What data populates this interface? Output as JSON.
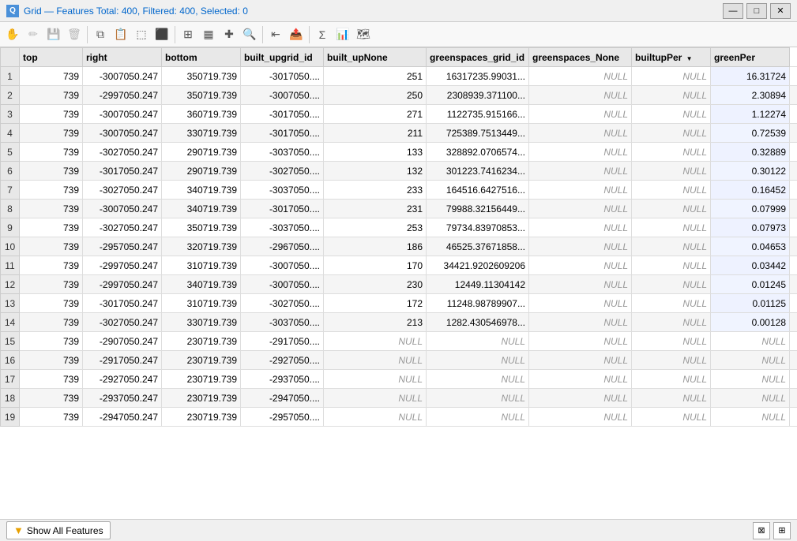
{
  "titleBar": {
    "icon": "Q",
    "title": "Grid — Features Total: 400, Filtered: 400, Selected: 0",
    "titleParts": {
      "prefix": "Grid — ",
      "stats": "Features Total: 400, Filtered: 400, Selected: 0"
    },
    "controls": {
      "minimize": "—",
      "maximize": "□",
      "close": "✕"
    }
  },
  "toolbar": {
    "buttons": [
      {
        "name": "pan-icon",
        "symbol": "✋",
        "tooltip": "Pan",
        "disabled": false
      },
      {
        "name": "edit-icon",
        "symbol": "✏️",
        "tooltip": "Edit",
        "disabled": true
      },
      {
        "name": "save-icon",
        "symbol": "💾",
        "tooltip": "Save",
        "disabled": true
      },
      {
        "name": "delete-icon",
        "symbol": "🗑",
        "tooltip": "Delete",
        "disabled": true
      },
      {
        "name": "separator1",
        "type": "separator"
      },
      {
        "name": "copy-icon",
        "symbol": "⧉",
        "tooltip": "Copy",
        "disabled": false
      },
      {
        "name": "paste-icon",
        "symbol": "📋",
        "tooltip": "Paste",
        "disabled": false
      },
      {
        "name": "zoom-icon",
        "symbol": "🔍",
        "tooltip": "Zoom",
        "disabled": false
      },
      {
        "name": "select-icon",
        "symbol": "⬛",
        "tooltip": "Select",
        "disabled": false
      },
      {
        "name": "separator2",
        "type": "separator"
      },
      {
        "name": "filter-icon",
        "symbol": "⊞",
        "tooltip": "Filter",
        "disabled": false
      },
      {
        "name": "table-icon",
        "symbol": "▦",
        "tooltip": "Table",
        "disabled": false
      },
      {
        "name": "add-col-icon",
        "symbol": "✚",
        "tooltip": "Add Column",
        "disabled": false
      },
      {
        "name": "search-icon",
        "symbol": "🔎",
        "tooltip": "Search",
        "disabled": false
      },
      {
        "name": "separator3",
        "type": "separator"
      },
      {
        "name": "move-top-icon",
        "symbol": "⇤",
        "tooltip": "Move Top",
        "disabled": false
      },
      {
        "name": "export-icon",
        "symbol": "📤",
        "tooltip": "Export",
        "disabled": false
      },
      {
        "name": "separator4",
        "type": "separator"
      },
      {
        "name": "stats-icon",
        "symbol": "Σ",
        "tooltip": "Statistics",
        "disabled": false
      },
      {
        "name": "chart-icon",
        "symbol": "📊",
        "tooltip": "Chart",
        "disabled": false
      },
      {
        "name": "map-icon",
        "symbol": "🗺",
        "tooltip": "Map",
        "disabled": false
      }
    ]
  },
  "columns": [
    {
      "id": "rownum",
      "label": "",
      "width": 24
    },
    {
      "id": "top",
      "label": "top",
      "width": 80
    },
    {
      "id": "right",
      "label": "right",
      "width": 100
    },
    {
      "id": "bottom",
      "label": "bottom",
      "width": 100
    },
    {
      "id": "built_upgrid_id",
      "label": "built_upgrid_id",
      "width": 105
    },
    {
      "id": "built_upNone",
      "label": "built_upNone",
      "width": 130
    },
    {
      "id": "greenspaces_grid_id",
      "label": "greenspaces_grid_id",
      "width": 130
    },
    {
      "id": "greenspaces_None",
      "label": "greenspaces_None",
      "width": 130
    },
    {
      "id": "builtupPer",
      "label": "builtupPer",
      "width": 100,
      "sorted": "desc"
    },
    {
      "id": "greenPer",
      "label": "greenPer",
      "width": 80
    }
  ],
  "rows": [
    {
      "num": 1,
      "top": "739",
      "right": "-3007050.247",
      "bottom": "350719.739",
      "btm2": "-3017050....",
      "built_upgrid_id": "251",
      "built_upNone": "16317235.99031...",
      "greenspaces_grid_id": "NULL",
      "greenspaces_None": "NULL",
      "builtupPer": "16.31724",
      "greenPer": "16.32"
    },
    {
      "num": 2,
      "top": "739",
      "right": "-2997050.247",
      "bottom": "350719.739",
      "btm2": "-3007050....",
      "built_upgrid_id": "250",
      "built_upNone": "2308939.371100...",
      "greenspaces_grid_id": "NULL",
      "greenspaces_None": "NULL",
      "builtupPer": "2.30894",
      "greenPer": "2.31"
    },
    {
      "num": 3,
      "top": "739",
      "right": "-3007050.247",
      "bottom": "360719.739",
      "btm2": "-3017050....",
      "built_upgrid_id": "271",
      "built_upNone": "1122735.915166...",
      "greenspaces_grid_id": "NULL",
      "greenspaces_None": "NULL",
      "builtupPer": "1.12274",
      "greenPer": "1.12"
    },
    {
      "num": 4,
      "top": "739",
      "right": "-3007050.247",
      "bottom": "330719.739",
      "btm2": "-3017050....",
      "built_upgrid_id": "211",
      "built_upNone": "725389.7513449...",
      "greenspaces_grid_id": "NULL",
      "greenspaces_None": "NULL",
      "builtupPer": "0.72539",
      "greenPer": "0.73"
    },
    {
      "num": 5,
      "top": "739",
      "right": "-3027050.247",
      "bottom": "290719.739",
      "btm2": "-3037050....",
      "built_upgrid_id": "133",
      "built_upNone": "328892.0706574...",
      "greenspaces_grid_id": "NULL",
      "greenspaces_None": "NULL",
      "builtupPer": "0.32889",
      "greenPer": "0.33"
    },
    {
      "num": 6,
      "top": "739",
      "right": "-3017050.247",
      "bottom": "290719.739",
      "btm2": "-3027050....",
      "built_upgrid_id": "132",
      "built_upNone": "301223.7416234...",
      "greenspaces_grid_id": "NULL",
      "greenspaces_None": "NULL",
      "builtupPer": "0.30122",
      "greenPer": "0.3"
    },
    {
      "num": 7,
      "top": "739",
      "right": "-3027050.247",
      "bottom": "340719.739",
      "btm2": "-3037050....",
      "built_upgrid_id": "233",
      "built_upNone": "164516.6427516...",
      "greenspaces_grid_id": "NULL",
      "greenspaces_None": "NULL",
      "builtupPer": "0.16452",
      "greenPer": "0.16"
    },
    {
      "num": 8,
      "top": "739",
      "right": "-3007050.247",
      "bottom": "340719.739",
      "btm2": "-3017050....",
      "built_upgrid_id": "231",
      "built_upNone": "79988.32156449...",
      "greenspaces_grid_id": "NULL",
      "greenspaces_None": "NULL",
      "builtupPer": "0.07999",
      "greenPer": "0.08"
    },
    {
      "num": 9,
      "top": "739",
      "right": "-3027050.247",
      "bottom": "350719.739",
      "btm2": "-3037050....",
      "built_upgrid_id": "253",
      "built_upNone": "79734.83970853...",
      "greenspaces_grid_id": "NULL",
      "greenspaces_None": "NULL",
      "builtupPer": "0.07973",
      "greenPer": "0.08"
    },
    {
      "num": 10,
      "top": "739",
      "right": "-2957050.247",
      "bottom": "320719.739",
      "btm2": "-2967050....",
      "built_upgrid_id": "186",
      "built_upNone": "46525.37671858...",
      "greenspaces_grid_id": "NULL",
      "greenspaces_None": "NULL",
      "builtupPer": "0.04653",
      "greenPer": "0.05"
    },
    {
      "num": 11,
      "top": "739",
      "right": "-2997050.247",
      "bottom": "310719.739",
      "btm2": "-3007050....",
      "built_upgrid_id": "170",
      "built_upNone": "34421.9202609206",
      "greenspaces_grid_id": "NULL",
      "greenspaces_None": "NULL",
      "builtupPer": "0.03442",
      "greenPer": "0.03"
    },
    {
      "num": 12,
      "top": "739",
      "right": "-2997050.247",
      "bottom": "340719.739",
      "btm2": "-3007050....",
      "built_upgrid_id": "230",
      "built_upNone": "12449.11304142",
      "greenspaces_grid_id": "NULL",
      "greenspaces_None": "NULL",
      "builtupPer": "0.01245",
      "greenPer": "0.01"
    },
    {
      "num": 13,
      "top": "739",
      "right": "-3017050.247",
      "bottom": "310719.739",
      "btm2": "-3027050....",
      "built_upgrid_id": "172",
      "built_upNone": "11248.98789907...",
      "greenspaces_grid_id": "NULL",
      "greenspaces_None": "NULL",
      "builtupPer": "0.01125",
      "greenPer": "0.01"
    },
    {
      "num": 14,
      "top": "739",
      "right": "-3027050.247",
      "bottom": "330719.739",
      "btm2": "-3037050....",
      "built_upgrid_id": "213",
      "built_upNone": "1282.430546978...",
      "greenspaces_grid_id": "NULL",
      "greenspaces_None": "NULL",
      "builtupPer": "0.00128",
      "greenPer": "0"
    },
    {
      "num": 15,
      "top": "739",
      "right": "-2907050.247",
      "bottom": "230719.739",
      "btm2": "-2917050....",
      "built_upgrid_id": "NULL",
      "built_upNone": "NULL",
      "greenspaces_grid_id": "NULL",
      "greenspaces_None": "NULL",
      "builtupPer": "NULL",
      "greenPer": "NULL"
    },
    {
      "num": 16,
      "top": "739",
      "right": "-2917050.247",
      "bottom": "230719.739",
      "btm2": "-2927050....",
      "built_upgrid_id": "NULL",
      "built_upNone": "NULL",
      "greenspaces_grid_id": "NULL",
      "greenspaces_None": "NULL",
      "builtupPer": "NULL",
      "greenPer": "NULL"
    },
    {
      "num": 17,
      "top": "739",
      "right": "-2927050.247",
      "bottom": "230719.739",
      "btm2": "-2937050....",
      "built_upgrid_id": "NULL",
      "built_upNone": "NULL",
      "greenspaces_grid_id": "NULL",
      "greenspaces_None": "NULL",
      "builtupPer": "NULL",
      "greenPer": "NULL"
    },
    {
      "num": 18,
      "top": "739",
      "right": "-2937050.247",
      "bottom": "230719.739",
      "btm2": "-2947050....",
      "built_upgrid_id": "NULL",
      "built_upNone": "NULL",
      "greenspaces_grid_id": "NULL",
      "greenspaces_None": "NULL",
      "builtupPer": "NULL",
      "greenPer": "NULL"
    },
    {
      "num": 19,
      "top": "739",
      "right": "-2947050.247",
      "bottom": "230719.739",
      "btm2": "-2957050....",
      "built_upgrid_id": "NULL",
      "built_upNone": "NULL",
      "greenspaces_grid_id": "NULL",
      "greenspaces_None": "NULL",
      "builtupPer": "NULL",
      "greenPer": "NULL"
    }
  ],
  "statusBar": {
    "showAllLabel": "Show All Features",
    "filterIcon": "▼"
  },
  "colors": {
    "accent": "#0066cc",
    "rowEven": "#f5f5f5",
    "rowOdd": "#ffffff",
    "headerBg": "#e8e8e8",
    "nullColor": "#999999",
    "sortedColBg": "#f0f4ff"
  }
}
